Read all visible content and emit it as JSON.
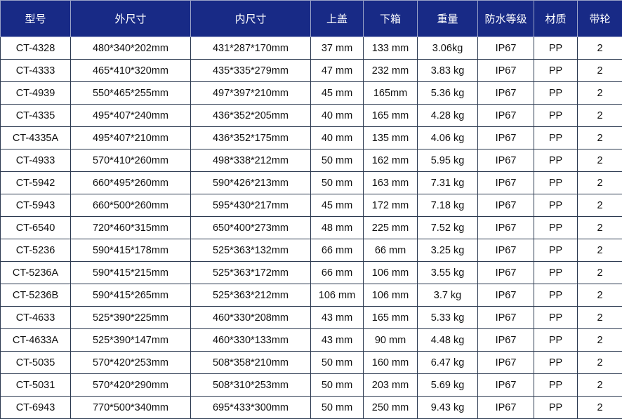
{
  "table": {
    "headers": [
      "型号",
      "外尺寸",
      "内尺寸",
      "上盖",
      "下箱",
      "重量",
      "防水等级",
      "材质",
      "带轮"
    ],
    "rows": [
      [
        "CT-4328",
        "480*340*202mm",
        "431*287*170mm",
        "37 mm",
        "133 mm",
        "3.06kg",
        "IP67",
        "PP",
        "2"
      ],
      [
        "CT-4333",
        "465*410*320mm",
        "435*335*279mm",
        "47 mm",
        "232 mm",
        "3.83 kg",
        "IP67",
        "PP",
        "2"
      ],
      [
        "CT-4939",
        "550*465*255mm",
        "497*397*210mm",
        "45 mm",
        "165mm",
        "5.36 kg",
        "IP67",
        "PP",
        "2"
      ],
      [
        "CT-4335",
        "495*407*240mm",
        "436*352*205mm",
        "40 mm",
        "165 mm",
        "4.28 kg",
        "IP67",
        "PP",
        "2"
      ],
      [
        "CT-4335A",
        "495*407*210mm",
        "436*352*175mm",
        "40 mm",
        "135 mm",
        "4.06 kg",
        "IP67",
        "PP",
        "2"
      ],
      [
        "CT-4933",
        "570*410*260mm",
        "498*338*212mm",
        "50 mm",
        "162 mm",
        "5.95 kg",
        "IP67",
        "PP",
        "2"
      ],
      [
        "CT-5942",
        "660*495*260mm",
        "590*426*213mm",
        "50 mm",
        "163 mm",
        "7.31 kg",
        "IP67",
        "PP",
        "2"
      ],
      [
        "CT-5943",
        "660*500*260mm",
        "595*430*217mm",
        "45 mm",
        "172 mm",
        "7.18 kg",
        "IP67",
        "PP",
        "2"
      ],
      [
        "CT-6540",
        "720*460*315mm",
        "650*400*273mm",
        "48 mm",
        "225 mm",
        "7.52 kg",
        "IP67",
        "PP",
        "2"
      ],
      [
        "CT-5236",
        "590*415*178mm",
        "525*363*132mm",
        "66 mm",
        "66 mm",
        "3.25 kg",
        "IP67",
        "PP",
        "2"
      ],
      [
        "CT-5236A",
        "590*415*215mm",
        "525*363*172mm",
        "66 mm",
        "106 mm",
        "3.55 kg",
        "IP67",
        "PP",
        "2"
      ],
      [
        "CT-5236B",
        "590*415*265mm",
        "525*363*212mm",
        "106 mm",
        "106 mm",
        "3.7 kg",
        "IP67",
        "PP",
        "2"
      ],
      [
        "CT-4633",
        "525*390*225mm",
        "460*330*208mm",
        "43 mm",
        "165 mm",
        "5.33 kg",
        "IP67",
        "PP",
        "2"
      ],
      [
        "CT-4633A",
        "525*390*147mm",
        "460*330*133mm",
        "43 mm",
        "90 mm",
        "4.48 kg",
        "IP67",
        "PP",
        "2"
      ],
      [
        "CT-5035",
        "570*420*253mm",
        "508*358*210mm",
        "50 mm",
        "160 mm",
        "6.47 kg",
        "IP67",
        "PP",
        "2"
      ],
      [
        "CT-5031",
        "570*420*290mm",
        "508*310*253mm",
        "50 mm",
        "203 mm",
        "5.69 kg",
        "IP67",
        "PP",
        "2"
      ],
      [
        "CT-6943",
        "770*500*340mm",
        "695*433*300mm",
        "50 mm",
        "250 mm",
        "9.43 kg",
        "IP67",
        "PP",
        "2"
      ]
    ]
  },
  "colors": {
    "header_bg": "#182a86",
    "header_text": "#ffffff",
    "border": "#2b3950"
  }
}
